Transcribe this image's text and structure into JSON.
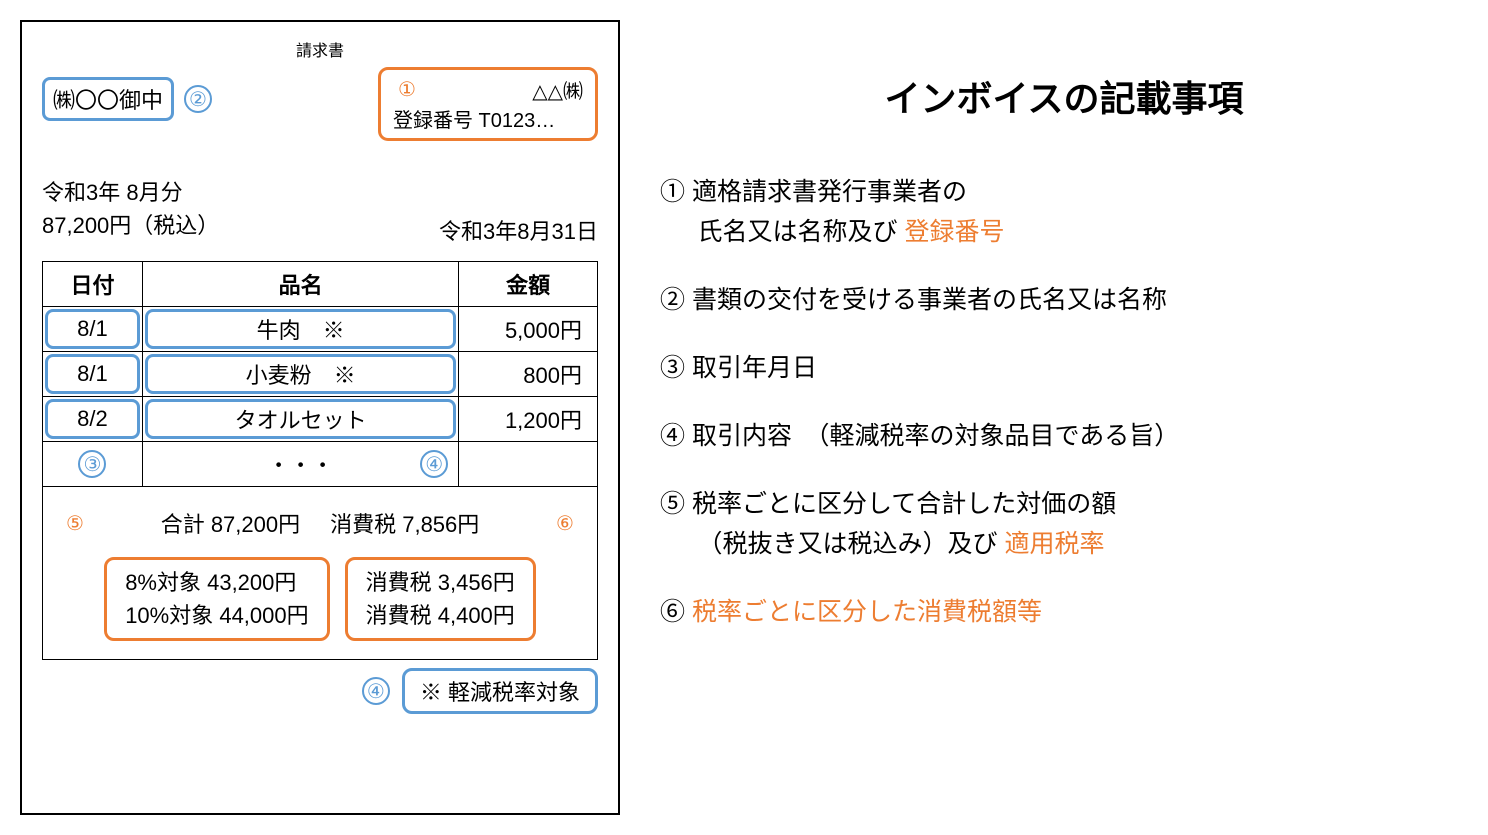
{
  "invoice": {
    "title": "請求書",
    "recipient": "㈱〇〇御中",
    "issuer_name": "△△㈱",
    "issuer_reg": "登録番号 T0123…",
    "month_label": "令和3年 8月分",
    "total_inc_tax": "87,200円（税込）",
    "issue_date": "令和3年8月31日",
    "table": {
      "headers": {
        "date": "日付",
        "item": "品名",
        "amount": "金額"
      },
      "rows": [
        {
          "date": "8/1",
          "item": "牛肉　※",
          "amount": "5,000円"
        },
        {
          "date": "8/1",
          "item": "小麦粉　※",
          "amount": "800円"
        },
        {
          "date": "8/2",
          "item": "タオルセット",
          "amount": "1,200円"
        }
      ],
      "ellipsis": "・・・"
    },
    "summary": {
      "total_label": "合計 87,200円",
      "tax_label": "消費税 7,856円",
      "rate8_base": "8%対象 43,200円",
      "rate10_base": "10%対象 44,000円",
      "rate8_tax": "消費税 3,456円",
      "rate10_tax": "消費税 4,400円"
    },
    "footnote": "※ 軽減税率対象"
  },
  "badges": {
    "n1": "①",
    "n2": "②",
    "n3": "③",
    "n4": "④",
    "n5": "⑤",
    "n6": "⑥"
  },
  "rules": {
    "title": "インボイスの記載事項",
    "r1a": "① 適格請求書発行事業者の",
    "r1b_prefix": "氏名又は名称及び ",
    "r1b_highlight": "登録番号",
    "r2": "② 書類の交付を受ける事業者の氏名又は名称",
    "r3": "③ 取引年月日",
    "r4": "④ 取引内容　（軽減税率の対象品目である旨）",
    "r5a": "⑤ 税率ごとに区分して合計した対価の額",
    "r5b_prefix": "（税抜き又は税込み）及び ",
    "r5b_highlight": "適用税率",
    "r6_prefix": "⑥ ",
    "r6_highlight": "税率ごとに区分した消費税額等"
  }
}
